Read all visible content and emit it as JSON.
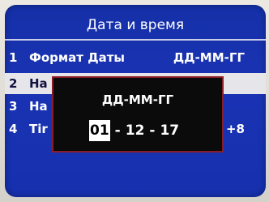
{
  "screen": {
    "title": "Дата и время"
  },
  "menu": {
    "items": [
      {
        "number": "1",
        "label": "Формат Даты",
        "value": "ДД-ММ-ГГ"
      },
      {
        "number": "2",
        "label": "На",
        "value": ""
      },
      {
        "number": "3",
        "label": "На",
        "value": ""
      },
      {
        "number": "4",
        "label": "Tir",
        "value": "+8"
      }
    ],
    "selected_index": 1
  },
  "dialog": {
    "title": "ДД-ММ-ГГ",
    "day": "01",
    "month": "12",
    "year": "17",
    "separator": "-",
    "focused_field": "day"
  }
}
